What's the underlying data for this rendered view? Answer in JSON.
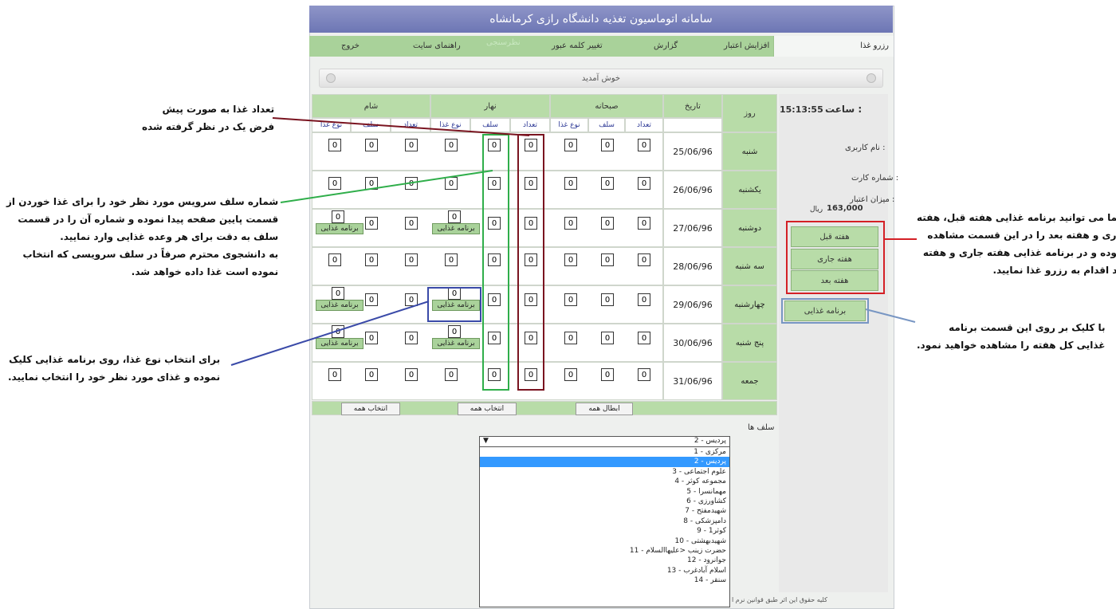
{
  "window": {
    "title": "سامانه اتوماسیون تغذیه دانشگاه رازی کرمانشاه"
  },
  "menu": {
    "reserve": "رزرو غذا",
    "credit": "افزایش اعتبار",
    "report": "گزارش",
    "change_pass": "تغییر کلمه عبور",
    "survey": "نظرسنجی",
    "help": "راهنمای سایت",
    "exit": "خروج"
  },
  "welcome": "خوش آمدید",
  "panel": {
    "time_label": "ساعت :",
    "time": "15:13:55",
    "username_label": "نام کاربری :",
    "card_label": "شماره کارت :",
    "credit_label": "میزان اعتبار :",
    "credit_value": "163,000",
    "currency": "ریال",
    "prev_week": "هفته قبل",
    "this_week": "هفته جاری",
    "next_week": "هفته بعد",
    "food_program": "برنامه غذایی"
  },
  "table": {
    "day_header": "روز",
    "date_header": "تاریخ",
    "breakfast": "صبحانه",
    "lunch": "نهار",
    "dinner": "شام",
    "count": "تعداد",
    "self": "سلف",
    "food_type": "نوع غذا",
    "cell_value": "0",
    "program_btn": "برنامه غذایی",
    "days": [
      {
        "day": "شنبه",
        "date": "25/06/96"
      },
      {
        "day": "یکشنبه",
        "date": "26/06/96"
      },
      {
        "day": "دوشنبه",
        "date": "27/06/96"
      },
      {
        "day": "سه شنبه",
        "date": "28/06/96"
      },
      {
        "day": "چهارشنبه",
        "date": "29/06/96"
      },
      {
        "day": "پنج شنبه",
        "date": "30/06/96"
      },
      {
        "day": "جمعه",
        "date": "31/06/96"
      }
    ],
    "cancel_all": "ابطال همه",
    "select_all": "انتخاب همه"
  },
  "selfs": {
    "label": "سلف ها",
    "selected": "2 - پردیس",
    "options": [
      "1 - مرکزی",
      "2 - پردیس",
      "3 - علوم اجتماعی",
      "4 - مجموعه کوثر",
      "5 - مهمانسرا",
      "6 - کشاورزی",
      "7 - شهیدمفتح",
      "8 - دامپزشکی",
      "9 - کوثر1",
      "10 - شهیدبهشتی",
      "11 - حضرت زینب <علیهاالسلام",
      "12 - جوانرود",
      "13 - اسلام آبادغرب",
      "14 - سنقر"
    ]
  },
  "footer": "کلیه حقوق این اثر طبق قوانین نرم ا",
  "annotations": {
    "count_default": [
      "تعداد غذا به صورت پیش",
      "فرض یک در نظر گرفته شده"
    ],
    "self_number": [
      "شماره سلف سرویس مورد نظر خود را برای غذا خوردن از",
      "قسمت پایین صفحه پیدا نموده و شماره آن را در قسمت",
      "سلف به دقت برای هر وعده غذایی وارد نمایید.",
      "به دانشجوی محترم صرفاً در سلف سرویسی که انتخاب",
      "نموده است غذا داده خواهد شد."
    ],
    "food_type": [
      "برای انتخاب نوع غذا، روی برنامه غذایی کلیک",
      "نموده و غذای مورد نظر خود را انتخاب نمایید."
    ],
    "weeks": [
      "شما می توانید برنامه غذایی هفته قبل، هفته",
      "جاری و هفته بعد را در این قسمت مشاهده",
      "نموده و در برنامه غذایی هفته جاری و هفته",
      "بعد اقدام به رزرو غذا نمایید."
    ],
    "program": [
      "با کلیک بر روی این قسمت برنامه",
      "غذایی کل هفته را مشاهده خواهید نمود."
    ]
  },
  "colors": {
    "red": "#d42026",
    "green": "#2fae4a",
    "blue": "#3a4aa8",
    "darkred": "#7a1420",
    "lightblue": "#7896c3"
  }
}
